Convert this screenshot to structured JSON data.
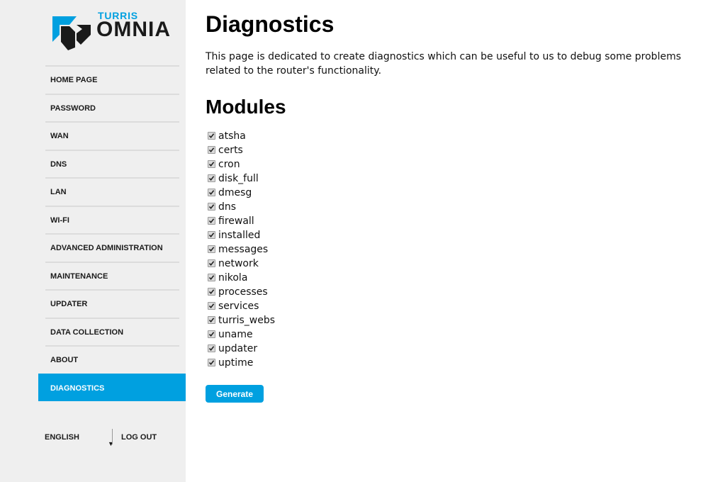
{
  "logo": {
    "small": "TURRIS",
    "big": "OMNIA"
  },
  "nav": {
    "items": [
      {
        "label": "HOME PAGE"
      },
      {
        "label": "PASSWORD"
      },
      {
        "label": "WAN"
      },
      {
        "label": "DNS"
      },
      {
        "label": "LAN"
      },
      {
        "label": "WI-FI"
      },
      {
        "label": "ADVANCED ADMINISTRATION"
      },
      {
        "label": "MAINTENANCE"
      },
      {
        "label": "UPDATER"
      },
      {
        "label": "DATA COLLECTION"
      },
      {
        "label": "ABOUT"
      },
      {
        "label": "DIAGNOSTICS",
        "active": true
      }
    ]
  },
  "footer": {
    "language": "ENGLISH",
    "logout": "LOG OUT"
  },
  "page": {
    "title": "Diagnostics",
    "intro": "This page is dedicated to create diagnostics which can be useful to us to debug some problems related to the router's functionality.",
    "modules_heading": "Modules",
    "generate_label": "Generate"
  },
  "modules": [
    {
      "name": "atsha",
      "checked": true
    },
    {
      "name": "certs",
      "checked": true
    },
    {
      "name": "cron",
      "checked": true
    },
    {
      "name": "disk_full",
      "checked": true
    },
    {
      "name": "dmesg",
      "checked": true
    },
    {
      "name": "dns",
      "checked": true
    },
    {
      "name": "firewall",
      "checked": true
    },
    {
      "name": "installed",
      "checked": true
    },
    {
      "name": "messages",
      "checked": true
    },
    {
      "name": "network",
      "checked": true
    },
    {
      "name": "nikola",
      "checked": true
    },
    {
      "name": "processes",
      "checked": true
    },
    {
      "name": "services",
      "checked": true
    },
    {
      "name": "turris_webs",
      "checked": true
    },
    {
      "name": "uname",
      "checked": true
    },
    {
      "name": "updater",
      "checked": true
    },
    {
      "name": "uptime",
      "checked": true
    }
  ],
  "colors": {
    "accent": "#00a0e0",
    "sidebar_bg": "#efefef"
  }
}
